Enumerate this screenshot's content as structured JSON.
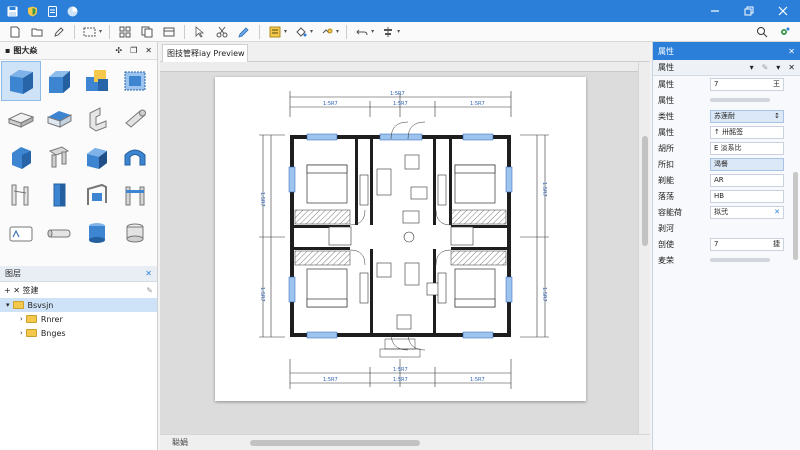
{
  "toolbar": {
    "icons": [
      "new-file-icon",
      "open-folder-icon",
      "pencil-icon",
      "select-rect-icon",
      "grid-icon",
      "pointer-icon",
      "cut-icon",
      "edit-icon",
      "align-icon",
      "fill-icon",
      "link-icon",
      "undo-icon",
      "distribute-icon",
      "search-icon",
      "settings-icon"
    ]
  },
  "shapes_panel": {
    "title": "图大焱"
  },
  "layers_panel": {
    "title": "图层",
    "toolbar_label": "+ ✕ 签建",
    "items": [
      {
        "label": "Bsvsjn",
        "selected": true
      },
      {
        "label": "Rnrer",
        "selected": false
      },
      {
        "label": "Bnges",
        "selected": false
      }
    ]
  },
  "document": {
    "tab_label": "图技管释iay Preview"
  },
  "status": {
    "label": "聪娟"
  },
  "properties": {
    "title": "属性",
    "sub_title": "属性",
    "rows": [
      {
        "label": "属性",
        "value": "7",
        "btn": "王"
      },
      {
        "label": "属性",
        "value": ""
      },
      {
        "label": "类性",
        "value": "苏莲耐",
        "highlight": true
      },
      {
        "label": "属性",
        "value": "↑ 卅酩签"
      },
      {
        "label": "胡所",
        "value": "E 淡系比"
      },
      {
        "label": "所扣",
        "value": "渴餐",
        "highlight": true
      },
      {
        "label": "剃能",
        "value": "AR"
      },
      {
        "label": "落荡",
        "value": "HB"
      },
      {
        "label": "容能荷",
        "value": "拟弐"
      },
      {
        "label": "剥河",
        "value": ""
      },
      {
        "label": "剖使",
        "value": "7",
        "btn": "捷"
      },
      {
        "label": "麦荣",
        "value": ""
      }
    ]
  },
  "plan": {
    "dim_label": "1:5R7"
  },
  "colors": {
    "accent": "#2b7fd9",
    "selection": "#cfe3f8",
    "shape_blue": "#3d84d1"
  }
}
